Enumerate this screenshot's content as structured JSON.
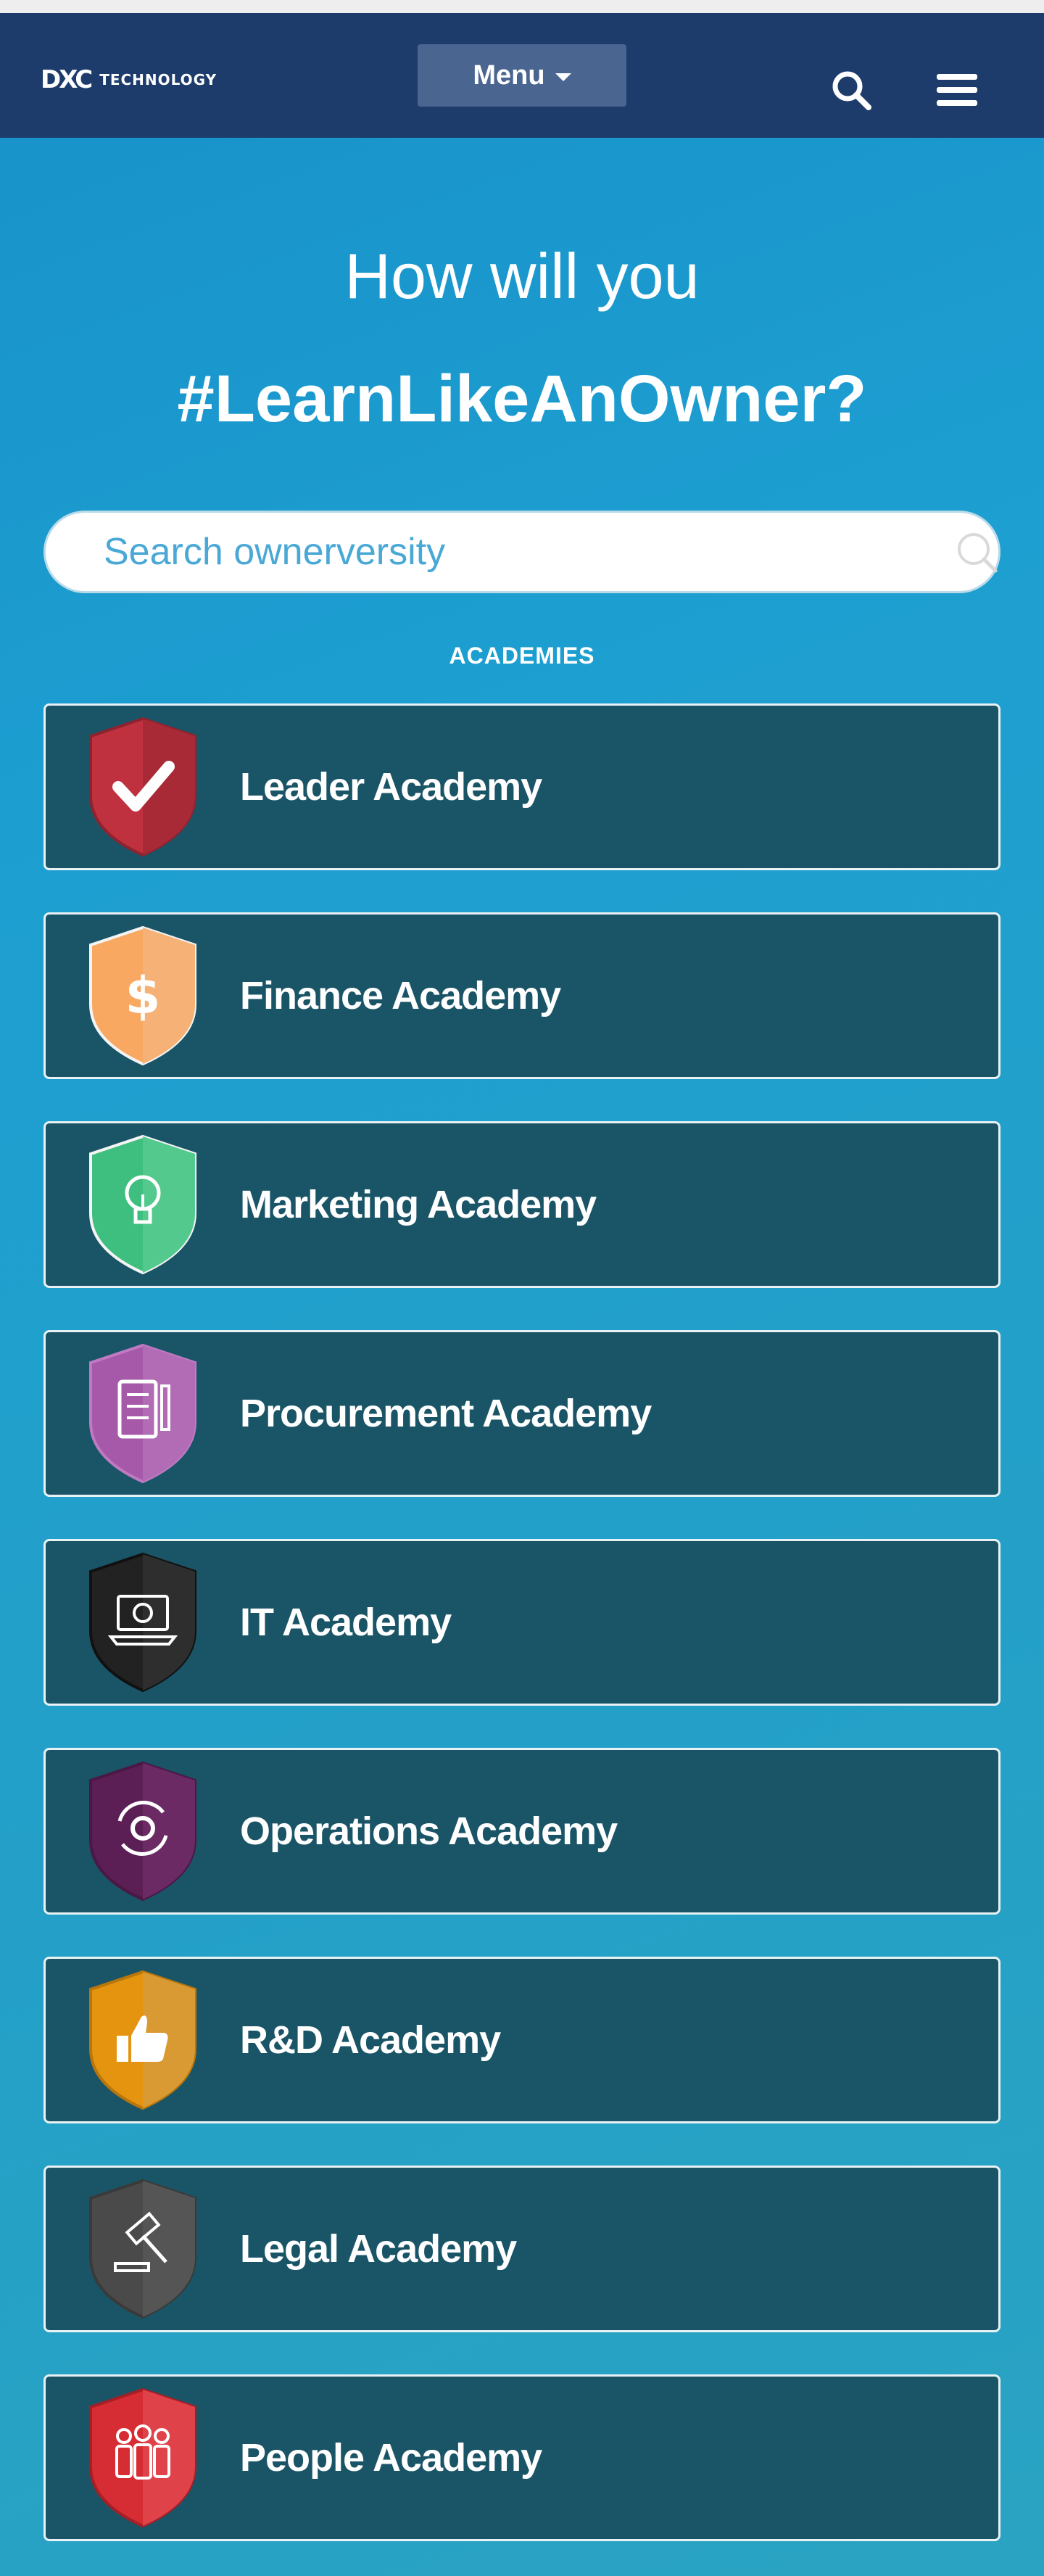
{
  "header": {
    "logo_mark": "DXC",
    "logo_text": "TECHNOLOGY",
    "menu_label": "Menu"
  },
  "hero": {
    "line1": "How will you",
    "line2": "#LearnLikeAnOwner?"
  },
  "search": {
    "placeholder": "Search ownerversity"
  },
  "academies_label": "ACADEMIES",
  "academies": [
    {
      "label": "Leader Academy",
      "color": "#c0313f",
      "icon": "checkmark-icon"
    },
    {
      "label": "Finance Academy",
      "color": "#f9a861",
      "icon": "dollar-icon"
    },
    {
      "label": "Marketing Academy",
      "color": "#3fbf7f",
      "icon": "lightbulb-icon"
    },
    {
      "label": "Procurement Academy",
      "color": "#a559a8",
      "icon": "clipboard-icon"
    },
    {
      "label": "IT Academy",
      "color": "#222222",
      "icon": "laptop-gear-icon"
    },
    {
      "label": "Operations Academy",
      "color": "#5c1f55",
      "icon": "cycle-gear-icon"
    },
    {
      "label": "R&D Academy",
      "color": "#e59410",
      "icon": "thumbs-up-icon"
    },
    {
      "label": "Legal Academy",
      "color": "#4a4a4a",
      "icon": "gavel-icon"
    },
    {
      "label": "People Academy",
      "color": "#d62d35",
      "icon": "people-icon"
    }
  ]
}
